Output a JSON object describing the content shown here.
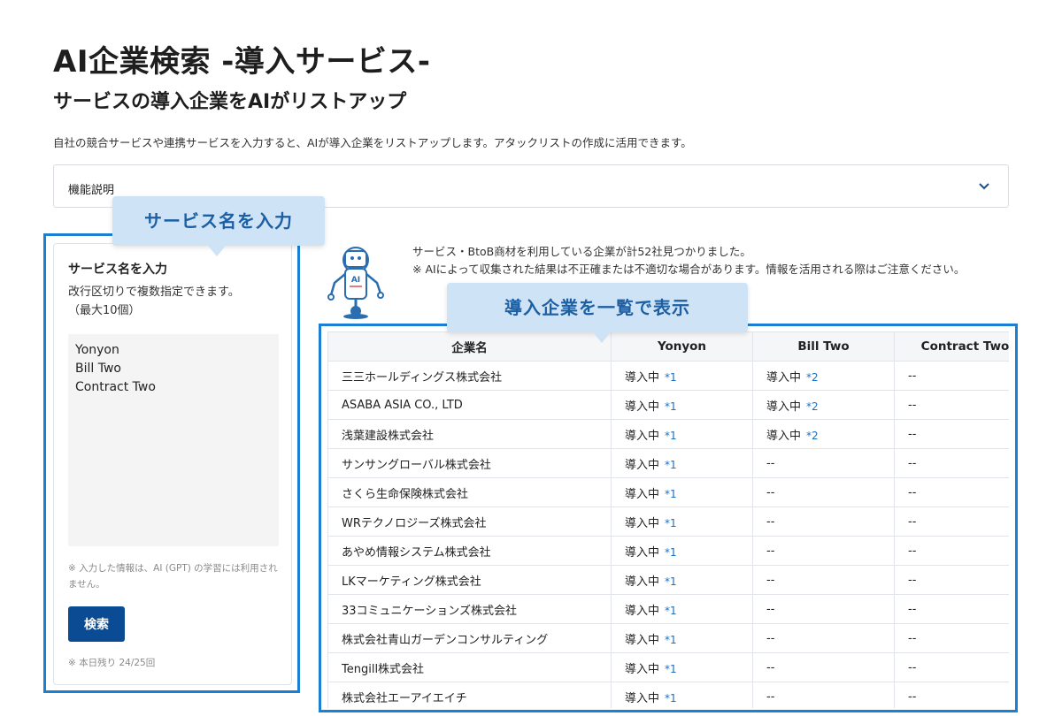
{
  "header": {
    "title": "AI企業検索 -導入サービス-",
    "subtitle": "サービスの導入企業をAIがリストアップ",
    "description": "自社の競合サービスや連携サービスを入力すると、AIが導入企業をリストアップします。アタックリストの作成に活用できます。"
  },
  "accordion": {
    "label": "機能説明",
    "icon": "chevron-down-icon"
  },
  "input_panel": {
    "heading": "サービス名を入力",
    "help_line1": "改行区切りで複数指定できます。",
    "help_line2": "（最大10個）",
    "textarea_value": "Yonyon\nBill Two\nContract Two",
    "note": "※ 入力した情報は、AI (GPT) の学習には利用されません。",
    "search_label": "検索",
    "remaining": "※ 本日残り 24/25回"
  },
  "callouts": {
    "input": "サービス名を入力",
    "list": "導入企業を一覧で表示"
  },
  "robot": {
    "badge": "AI"
  },
  "results": {
    "summary_line1": "サービス・BtoB商材を利用している企業が計52社見つかりました。",
    "summary_line2": "※ AIによって収集された結果は不正確または不適切な場合があります。情報を活用される際はご注意ください。",
    "columns": [
      "企業名",
      "Yonyon",
      "Bill Two",
      "Contract Two"
    ],
    "rows": [
      [
        "三三ホールディングス株式会社",
        "導入中",
        "*1",
        "導入中",
        "*2",
        "--"
      ],
      [
        "ASABA ASIA CO., LTD",
        "導入中",
        "*1",
        "導入中",
        "*2",
        "--"
      ],
      [
        "浅葉建設株式会社",
        "導入中",
        "*1",
        "導入中",
        "*2",
        "--"
      ],
      [
        "サンサングローバル株式会社",
        "導入中",
        "*1",
        "--",
        "",
        "--"
      ],
      [
        "さくら生命保険株式会社",
        "導入中",
        "*1",
        "--",
        "",
        "--"
      ],
      [
        "WRテクノロジーズ株式会社",
        "導入中",
        "*1",
        "--",
        "",
        "--"
      ],
      [
        "あやめ情報システム株式会社",
        "導入中",
        "*1",
        "--",
        "",
        "--"
      ],
      [
        "LKマーケティング株式会社",
        "導入中",
        "*1",
        "--",
        "",
        "--"
      ],
      [
        "33コミュニケーションズ株式会社",
        "導入中",
        "*1",
        "--",
        "",
        "--"
      ],
      [
        "株式会社青山ガーデンコンサルティング",
        "導入中",
        "*1",
        "--",
        "",
        "--"
      ],
      [
        "Tengill株式会社",
        "導入中",
        "*1",
        "--",
        "",
        "--"
      ],
      [
        "株式会社エーアイエイチ",
        "導入中",
        "*1",
        "--",
        "",
        "--"
      ]
    ]
  }
}
